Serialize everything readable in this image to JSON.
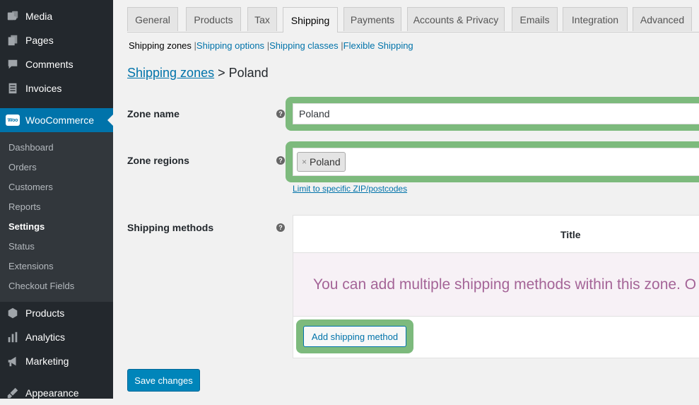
{
  "sidebar": {
    "top_items": [
      {
        "label": "Media",
        "icon": "media-icon"
      },
      {
        "label": "Pages",
        "icon": "pages-icon"
      },
      {
        "label": "Comments",
        "icon": "comments-icon"
      },
      {
        "label": "Invoices",
        "icon": "invoices-icon"
      }
    ],
    "woocommerce": {
      "label": "WooCommerce",
      "badge": "Woo"
    },
    "submenu": [
      "Dashboard",
      "Orders",
      "Customers",
      "Reports",
      "Settings",
      "Status",
      "Extensions",
      "Checkout Fields"
    ],
    "bottom_items": [
      {
        "label": "Products",
        "icon": "products-icon"
      },
      {
        "label": "Analytics",
        "icon": "analytics-icon"
      },
      {
        "label": "Marketing",
        "icon": "marketing-icon"
      },
      {
        "label": "Appearance",
        "icon": "appearance-icon"
      }
    ]
  },
  "tabs": [
    "General",
    "Products",
    "Tax",
    "Shipping",
    "Payments",
    "Accounts & Privacy",
    "Emails",
    "Integration",
    "Advanced"
  ],
  "active_tab": "Shipping",
  "subsub": {
    "current": "Shipping zones",
    "links": [
      "Shipping options",
      "Shipping classes",
      "Flexible Shipping"
    ],
    "separator": "|"
  },
  "breadcrumb": {
    "link": "Shipping zones",
    "separator": ">",
    "current": "Poland"
  },
  "form": {
    "zone_name_label": "Zone name",
    "zone_name_value": "Poland",
    "zone_regions_label": "Zone regions",
    "region_chip_remove": "×",
    "region_chip": "Poland",
    "zip_link": "Limit to specific ZIP/postcodes",
    "shipping_methods_label": "Shipping methods",
    "help_glyph": "?"
  },
  "methods_table": {
    "column_title": "Title",
    "blank_message": "You can add multiple shipping methods within this zone. O",
    "add_button": "Add shipping method"
  },
  "save_button": "Save changes",
  "colors": {
    "accent": "#0073aa",
    "highlight": "#7dba7d",
    "woo_purple": "#a46497"
  }
}
